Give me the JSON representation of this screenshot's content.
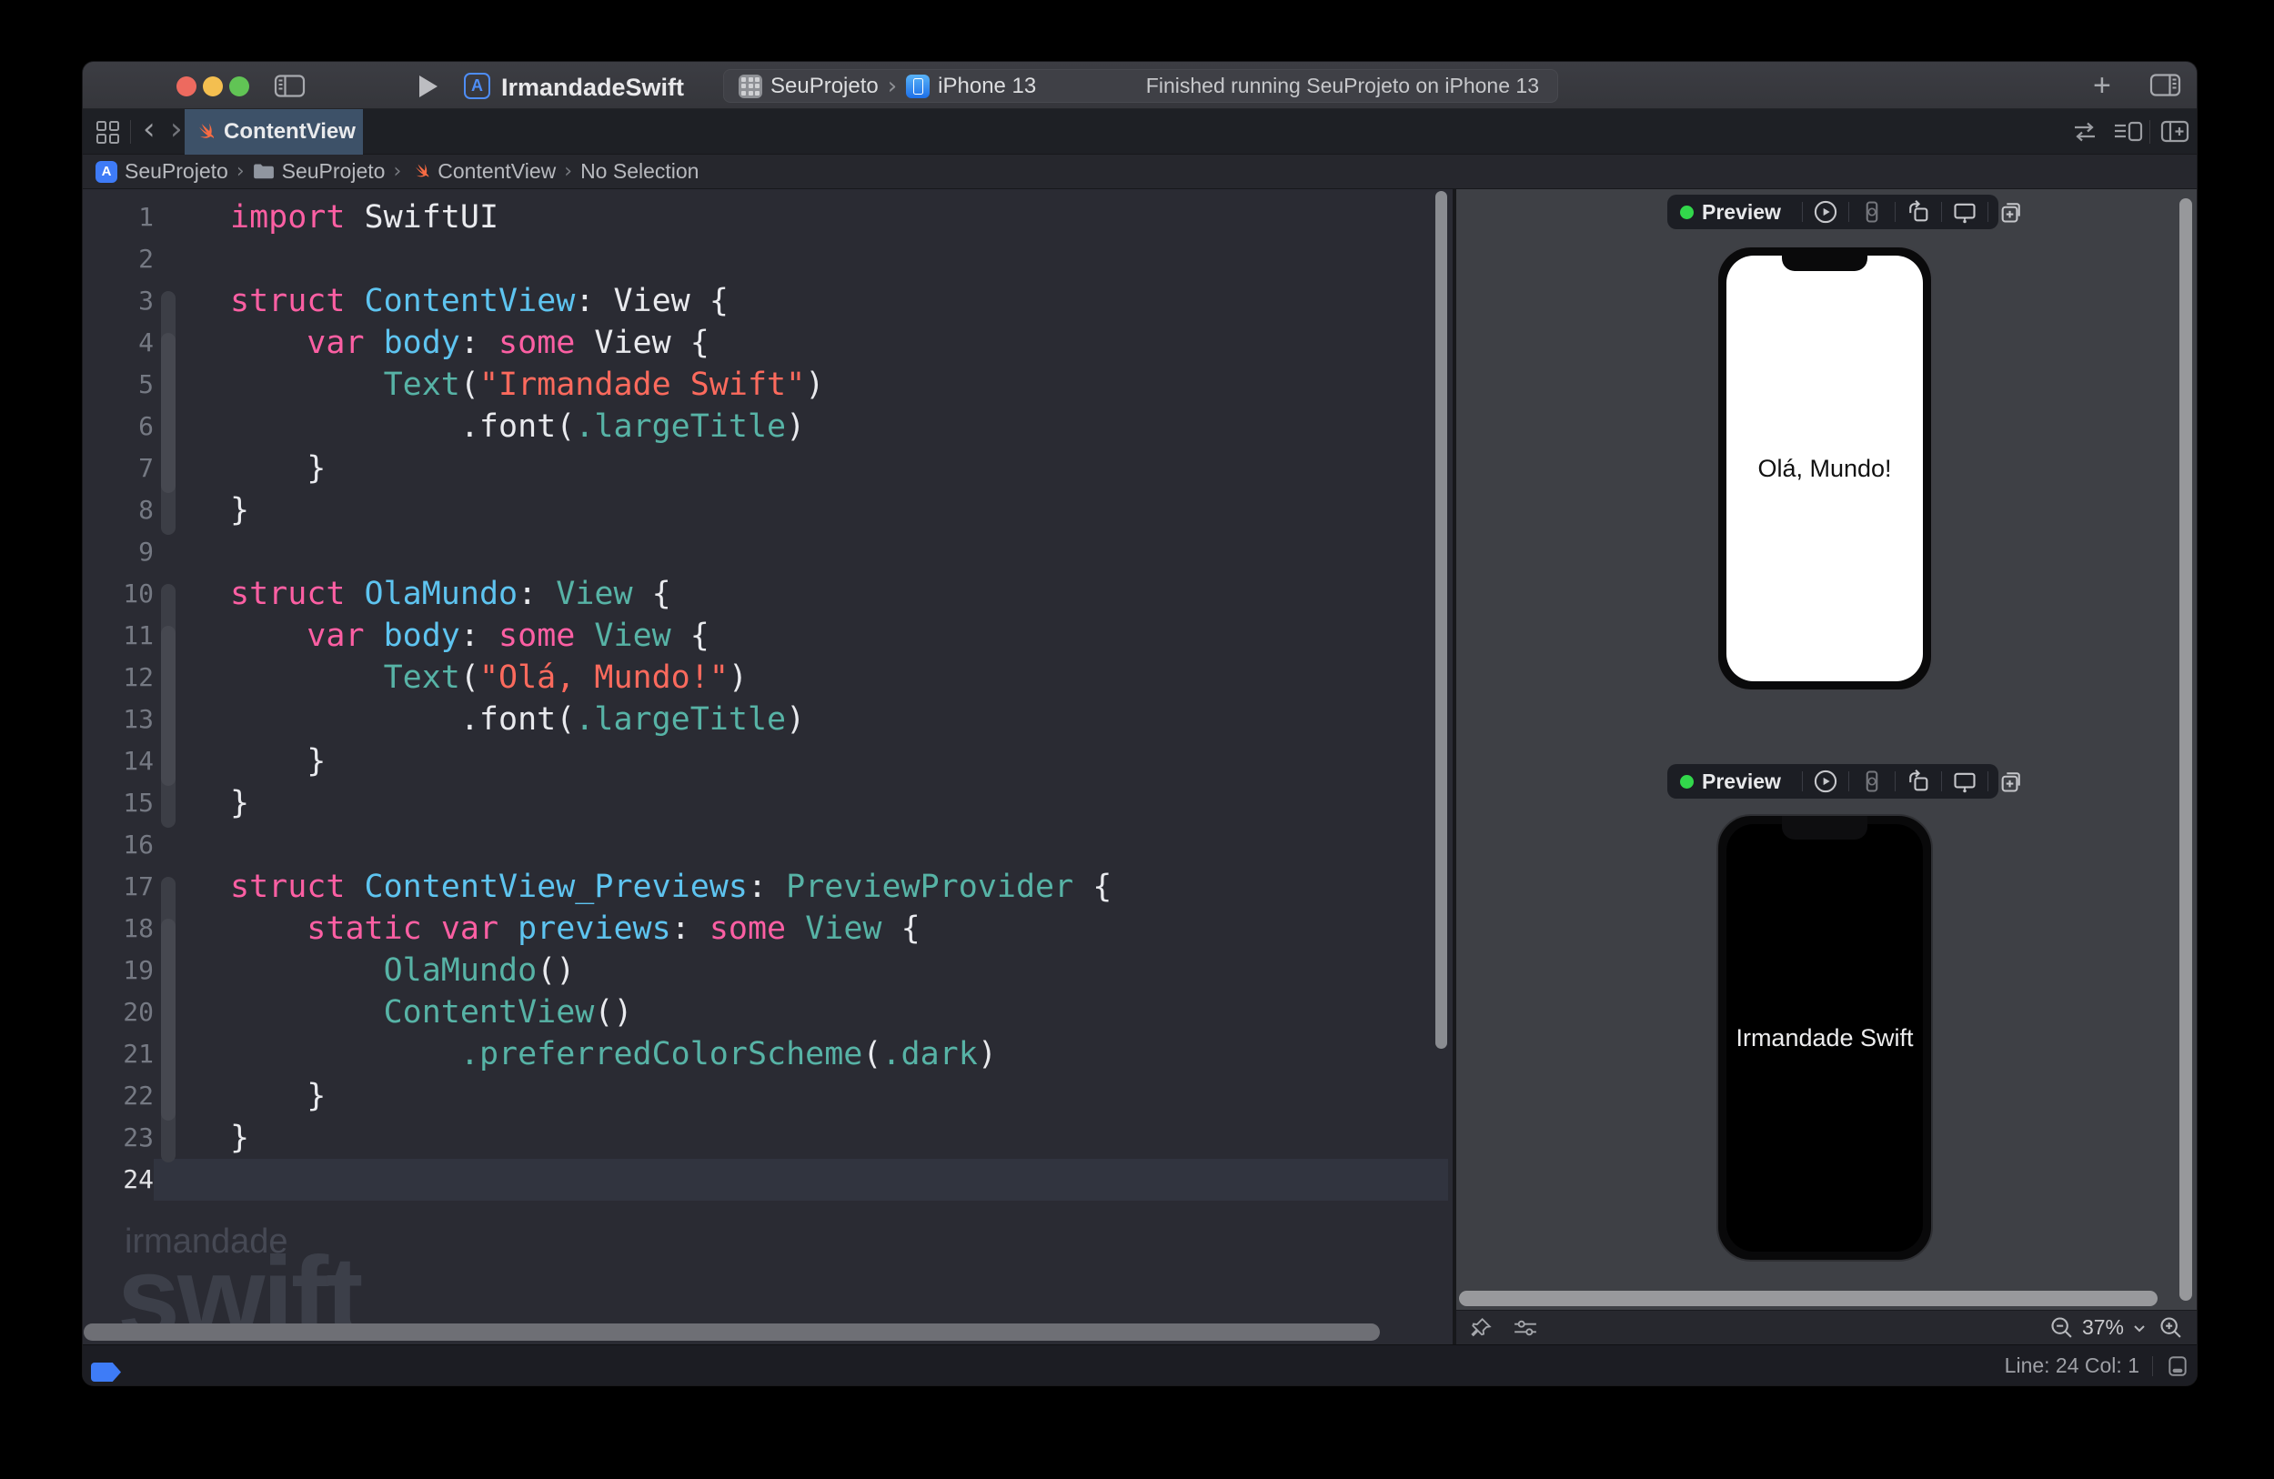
{
  "colors": {
    "accent_blue": "#3E7CF7",
    "swift_orange": "#F86B43",
    "preview_green": "#32D74B",
    "keyword_pink": "#FC5FA3",
    "declaration_blue": "#5EC4F0",
    "sdk_teal": "#57B3A6",
    "string_red": "#FC6A5D",
    "tab_selected": "#3D5168"
  },
  "titlebar": {
    "window_title": "IrmandadeSwift",
    "app_badge_letter": "A",
    "scheme": {
      "project": "SeuProjeto",
      "destination": "iPhone 13",
      "separator": "›"
    },
    "run_status": "Finished running SeuProjeto on iPhone 13",
    "plus_glyph": "+"
  },
  "tabbar": {
    "back_glyph": "‹",
    "forward_glyph": "›",
    "tabs": [
      {
        "label": "ContentView",
        "active": true
      }
    ]
  },
  "breadcrumb": {
    "separator": "›",
    "app_badge_letter": "A",
    "items": [
      "SeuProjeto",
      "SeuProjeto",
      "ContentView",
      "No Selection"
    ]
  },
  "editor": {
    "watermark": {
      "line1": "irmandade",
      "line2": "swift"
    },
    "folds": [
      {
        "start": 3,
        "end": 8,
        "shade": "outer"
      },
      {
        "start": 4,
        "end": 7,
        "shade": "inner"
      },
      {
        "start": 10,
        "end": 15,
        "shade": "outer"
      },
      {
        "start": 11,
        "end": 14,
        "shade": "inner"
      },
      {
        "start": 17,
        "end": 23,
        "shade": "outer"
      },
      {
        "start": 18,
        "end": 22,
        "shade": "inner"
      }
    ],
    "lines": [
      {
        "n": 1,
        "tokens": [
          {
            "t": "import",
            "c": "k"
          },
          {
            "t": " SwiftUI",
            "c": "p"
          }
        ]
      },
      {
        "n": 2,
        "tokens": []
      },
      {
        "n": 3,
        "tokens": [
          {
            "t": "struct",
            "c": "k"
          },
          {
            "t": " ",
            "c": "p"
          },
          {
            "t": "ContentView",
            "c": "d"
          },
          {
            "t": ": View {",
            "c": "p"
          }
        ]
      },
      {
        "n": 4,
        "tokens": [
          {
            "t": "    ",
            "c": "p"
          },
          {
            "t": "var",
            "c": "k"
          },
          {
            "t": " ",
            "c": "p"
          },
          {
            "t": "body",
            "c": "d"
          },
          {
            "t": ": ",
            "c": "p"
          },
          {
            "t": "some",
            "c": "k"
          },
          {
            "t": " View {",
            "c": "p"
          }
        ]
      },
      {
        "n": 5,
        "tokens": [
          {
            "t": "        ",
            "c": "p"
          },
          {
            "t": "Text",
            "c": "s"
          },
          {
            "t": "(",
            "c": "p"
          },
          {
            "t": "\"Irmandade Swift\"",
            "c": "r"
          },
          {
            "t": ")",
            "c": "p"
          }
        ]
      },
      {
        "n": 6,
        "tokens": [
          {
            "t": "            .font(",
            "c": "p"
          },
          {
            "t": ".largeTitle",
            "c": "s"
          },
          {
            "t": ")",
            "c": "p"
          }
        ]
      },
      {
        "n": 7,
        "tokens": [
          {
            "t": "    }",
            "c": "p"
          }
        ]
      },
      {
        "n": 8,
        "tokens": [
          {
            "t": "}",
            "c": "p"
          }
        ]
      },
      {
        "n": 9,
        "tokens": []
      },
      {
        "n": 10,
        "tokens": [
          {
            "t": "struct",
            "c": "k"
          },
          {
            "t": " ",
            "c": "p"
          },
          {
            "t": "OlaMundo",
            "c": "d"
          },
          {
            "t": ": ",
            "c": "p"
          },
          {
            "t": "View",
            "c": "s"
          },
          {
            "t": " {",
            "c": "p"
          }
        ]
      },
      {
        "n": 11,
        "tokens": [
          {
            "t": "    ",
            "c": "p"
          },
          {
            "t": "var",
            "c": "k"
          },
          {
            "t": " ",
            "c": "p"
          },
          {
            "t": "body",
            "c": "d"
          },
          {
            "t": ": ",
            "c": "p"
          },
          {
            "t": "some",
            "c": "k"
          },
          {
            "t": " ",
            "c": "p"
          },
          {
            "t": "View",
            "c": "s"
          },
          {
            "t": " {",
            "c": "p"
          }
        ]
      },
      {
        "n": 12,
        "tokens": [
          {
            "t": "        ",
            "c": "p"
          },
          {
            "t": "Text",
            "c": "s"
          },
          {
            "t": "(",
            "c": "p"
          },
          {
            "t": "\"Olá, Mundo!\"",
            "c": "r"
          },
          {
            "t": ")",
            "c": "p"
          }
        ]
      },
      {
        "n": 13,
        "tokens": [
          {
            "t": "            .font(",
            "c": "p"
          },
          {
            "t": ".largeTitle",
            "c": "s"
          },
          {
            "t": ")",
            "c": "p"
          }
        ]
      },
      {
        "n": 14,
        "tokens": [
          {
            "t": "    }",
            "c": "p"
          }
        ]
      },
      {
        "n": 15,
        "tokens": [
          {
            "t": "}",
            "c": "p"
          }
        ]
      },
      {
        "n": 16,
        "tokens": []
      },
      {
        "n": 17,
        "tokens": [
          {
            "t": "struct",
            "c": "k"
          },
          {
            "t": " ",
            "c": "p"
          },
          {
            "t": "ContentView_Previews",
            "c": "d"
          },
          {
            "t": ": ",
            "c": "p"
          },
          {
            "t": "PreviewProvider",
            "c": "s"
          },
          {
            "t": " {",
            "c": "p"
          }
        ]
      },
      {
        "n": 18,
        "tokens": [
          {
            "t": "    ",
            "c": "p"
          },
          {
            "t": "static",
            "c": "k"
          },
          {
            "t": " ",
            "c": "p"
          },
          {
            "t": "var",
            "c": "k"
          },
          {
            "t": " ",
            "c": "p"
          },
          {
            "t": "previews",
            "c": "d"
          },
          {
            "t": ": ",
            "c": "p"
          },
          {
            "t": "some",
            "c": "k"
          },
          {
            "t": " ",
            "c": "p"
          },
          {
            "t": "View",
            "c": "s"
          },
          {
            "t": " {",
            "c": "p"
          }
        ]
      },
      {
        "n": 19,
        "tokens": [
          {
            "t": "        ",
            "c": "p"
          },
          {
            "t": "OlaMundo",
            "c": "s"
          },
          {
            "t": "()",
            "c": "p"
          }
        ]
      },
      {
        "n": 20,
        "tokens": [
          {
            "t": "        ",
            "c": "p"
          },
          {
            "t": "ContentView",
            "c": "s"
          },
          {
            "t": "()",
            "c": "p"
          }
        ]
      },
      {
        "n": 21,
        "tokens": [
          {
            "t": "            ",
            "c": "p"
          },
          {
            "t": ".preferredColorScheme",
            "c": "s"
          },
          {
            "t": "(",
            "c": "p"
          },
          {
            "t": ".dark",
            "c": "s"
          },
          {
            "t": ")",
            "c": "p"
          }
        ]
      },
      {
        "n": 22,
        "tokens": [
          {
            "t": "    }",
            "c": "p"
          }
        ]
      },
      {
        "n": 23,
        "tokens": [
          {
            "t": "}",
            "c": "p"
          }
        ]
      },
      {
        "n": 24,
        "tokens": [],
        "current": true
      }
    ]
  },
  "preview": {
    "groups": [
      {
        "label": "Preview",
        "phone": {
          "text": "Olá, Mundo!",
          "scheme": "light"
        }
      },
      {
        "label": "Preview",
        "phone": {
          "text": "Irmandade Swift",
          "scheme": "dark"
        }
      }
    ],
    "zoom": {
      "value": "37%"
    }
  },
  "statusbar": {
    "position": "Line: 24  Col: 1"
  }
}
